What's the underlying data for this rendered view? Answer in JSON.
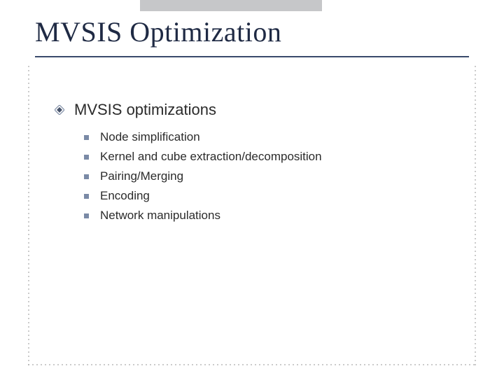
{
  "slide": {
    "title": "MVSIS Optimization",
    "lvl1": "MVSIS optimizations",
    "items": [
      "Node simplification",
      "Kernel and cube extraction/decomposition",
      "Pairing/Merging",
      "Encoding",
      "Network manipulations"
    ]
  }
}
